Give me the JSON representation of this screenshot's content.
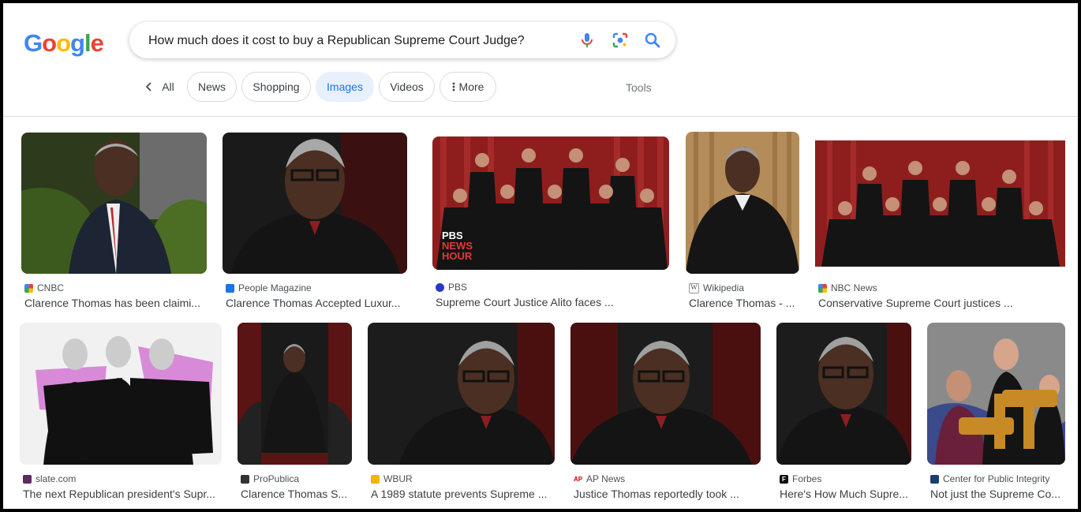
{
  "logo": {
    "letters": [
      "G",
      "o",
      "o",
      "g",
      "l",
      "e"
    ],
    "colors": [
      "#4285F4",
      "#EA4335",
      "#FBBC05",
      "#4285F4",
      "#34A853",
      "#EA4335"
    ]
  },
  "search": {
    "query": "How much does it cost to buy a Republican Supreme Court Judge?"
  },
  "icons": {
    "voice": "microphone-icon",
    "lens": "camera-lens-icon",
    "search": "magnifier-icon"
  },
  "tabs": {
    "all": "All",
    "news": "News",
    "shopping": "Shopping",
    "images": "Images",
    "videos": "Videos",
    "more": "More",
    "tools": "Tools"
  },
  "results": [
    {
      "source": "CNBC",
      "title": "Clarence Thomas has been claimi..."
    },
    {
      "source": "People Magazine",
      "title": "Clarence Thomas Accepted Luxur..."
    },
    {
      "source": "PBS",
      "title": "Supreme Court Justice Alito faces ...",
      "overlay": [
        "PBS",
        "NEWS",
        "HOUR"
      ]
    },
    {
      "source": "Wikipedia",
      "title": "Clarence Thomas - ..."
    },
    {
      "source": "NBC News",
      "title": "Conservative Supreme Court justices ..."
    },
    {
      "source": "slate.com",
      "title": "The next Republican president's Supr..."
    },
    {
      "source": "ProPublica",
      "title": "Clarence Thomas S..."
    },
    {
      "source": "WBUR",
      "title": "A 1989 statute prevents Supreme ..."
    },
    {
      "source": "AP News",
      "title": "Justice Thomas reportedly took ..."
    },
    {
      "source": "Forbes",
      "title": "Here's How Much Supre..."
    },
    {
      "source": "Center for Public Integrity",
      "title": "Not just the Supreme Co..."
    }
  ],
  "colors": {
    "accent": "#1a73e8",
    "robe": "#1b1b1f",
    "curtain": "#a32626",
    "slate_pink": "#d88ad8"
  }
}
